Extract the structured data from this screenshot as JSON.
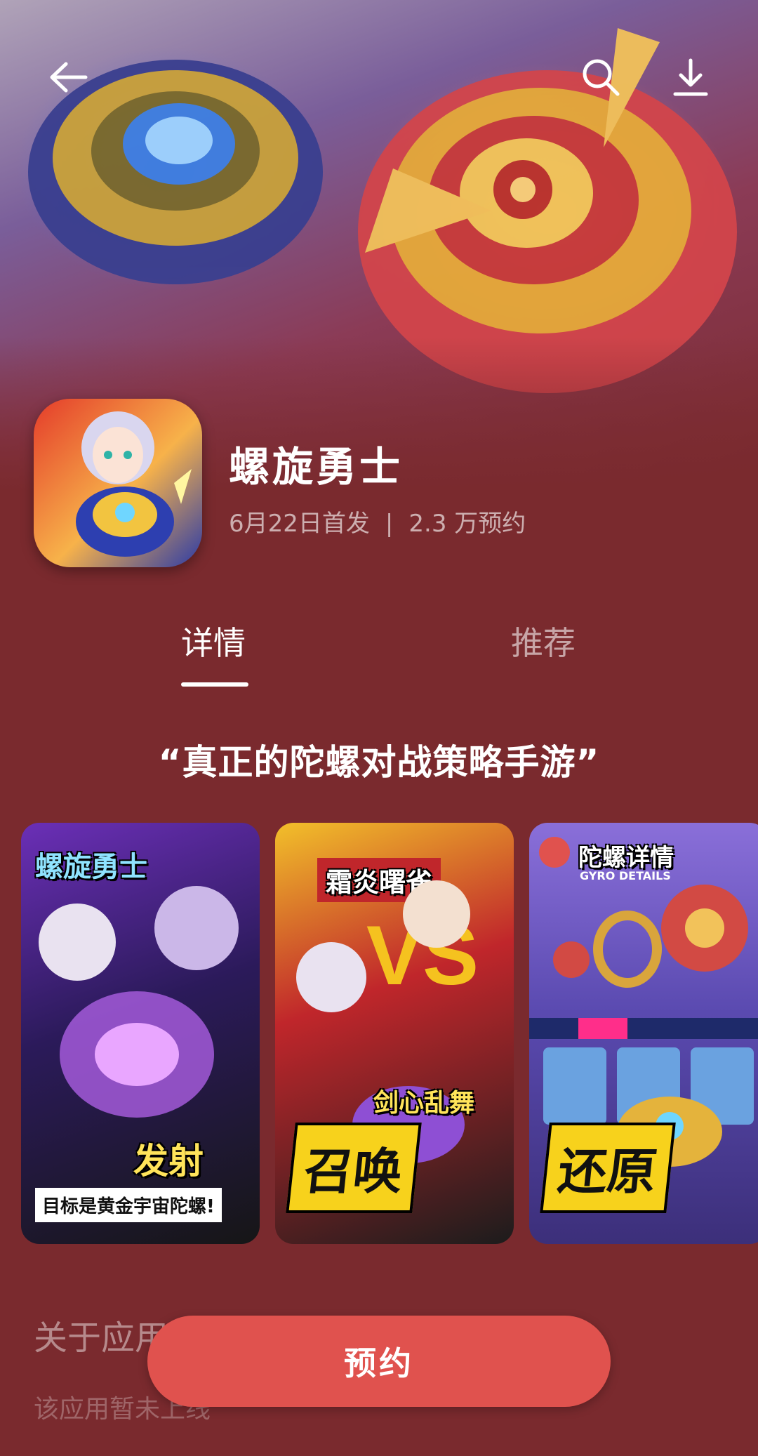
{
  "header": {
    "back_icon": "arrow-left-icon",
    "search_icon": "search-icon",
    "download_icon": "download-icon"
  },
  "app": {
    "name": "螺旋勇士",
    "release": "6月22日首发",
    "separator": "|",
    "reservations": "2.3 万预约"
  },
  "tabs": [
    {
      "label": "详情",
      "active": true
    },
    {
      "label": "推荐",
      "active": false
    }
  ],
  "tagline": "“真正的陀螺对战策略手游”",
  "screenshots": [
    {
      "caption_top": "螺旋勇士",
      "caption_bottom": "发射",
      "caption_small": "目标是黄金宇宙陀螺!"
    },
    {
      "caption_top": "霜炎曙雀",
      "caption_bottom": "召唤",
      "caption_small": "剑心乱舞"
    },
    {
      "caption_top": "陀螺详情",
      "caption_bottom": "还原",
      "caption_small": "GYRO DETAILS"
    }
  ],
  "about": {
    "title": "关于应用",
    "text": "该应用暂未上线"
  },
  "cta": {
    "label": "预约"
  },
  "colors": {
    "background": "#7a2a2e",
    "button": "#e0524e",
    "tab_active": "#ffffff"
  }
}
